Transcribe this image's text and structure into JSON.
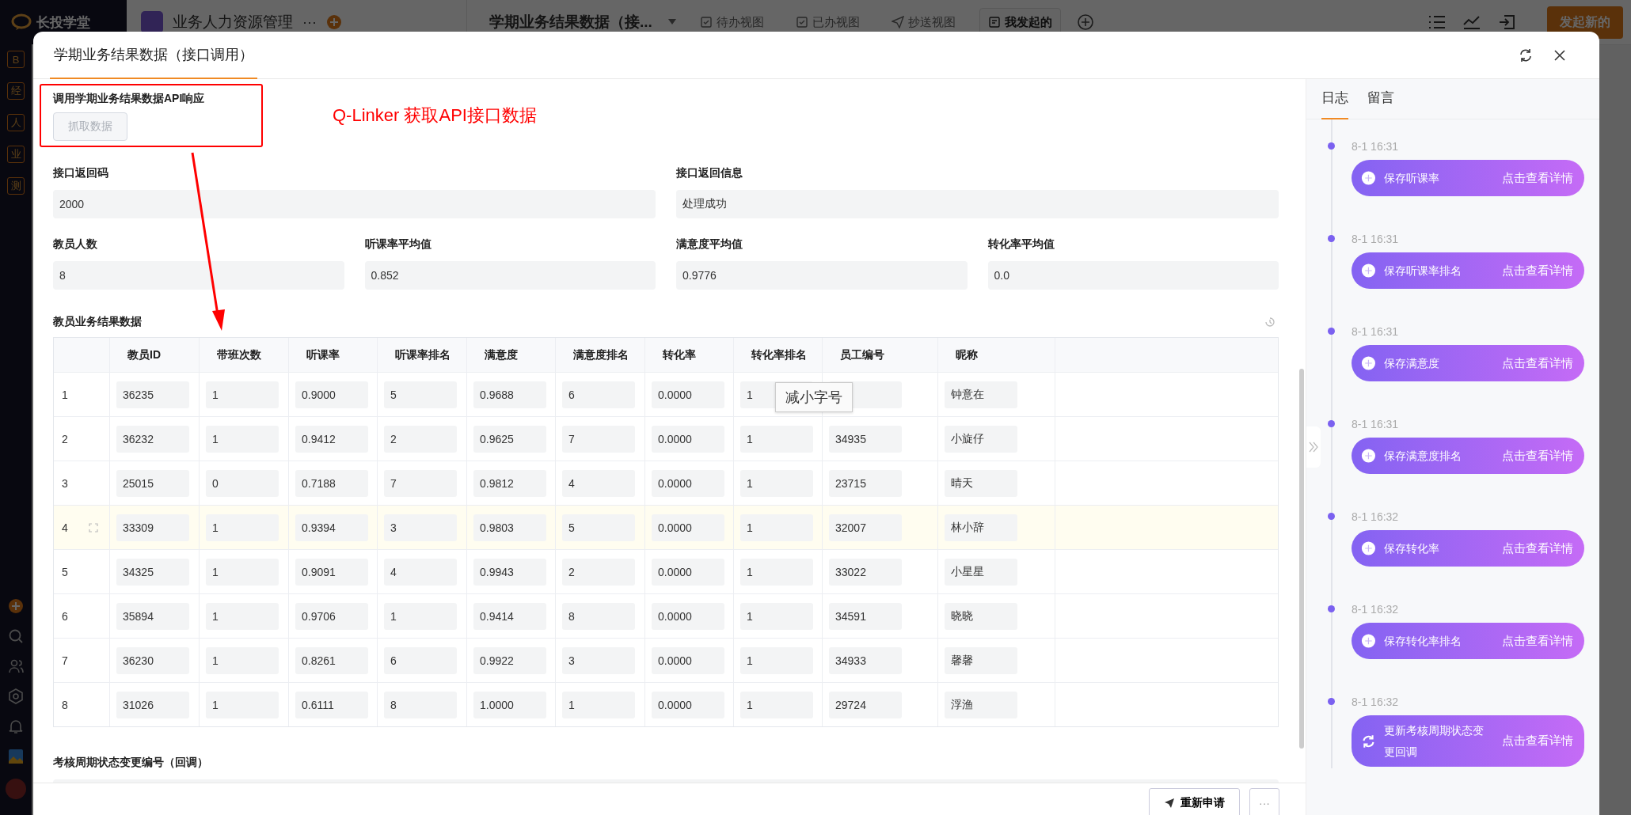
{
  "app": {
    "logo": "长投学堂",
    "app_name": "业务人力资源管理",
    "more": "···",
    "form_title": "学期业务结果数据（接...",
    "views": [
      {
        "label": "待办视图",
        "kind": "todo",
        "selected": false
      },
      {
        "label": "已办视图",
        "kind": "done",
        "selected": false
      },
      {
        "label": "抄送视图",
        "kind": "cc",
        "selected": false
      },
      {
        "label": "我发起的",
        "kind": "mine",
        "selected": true
      }
    ],
    "primary_button": "发起新的",
    "sidebar_letters": [
      "B",
      "经",
      "人",
      "业",
      "测"
    ]
  },
  "modal": {
    "tab": "学期业务结果数据（接口调用）",
    "api_section": {
      "label": "调用学期业务结果数据API响应",
      "button": "抓取数据",
      "button_disabled": true
    },
    "annotation": "Q-Linker 获取API接口数据",
    "field_rows": [
      [
        {
          "label": "接口返回码",
          "value": "2000"
        },
        {
          "label": "接口返回信息",
          "value": "处理成功"
        }
      ],
      [
        {
          "label": "教员人数",
          "value": "8"
        },
        {
          "label": "听课率平均值",
          "value": "0.852"
        },
        {
          "label": "满意度平均值",
          "value": "0.9776"
        },
        {
          "label": "转化率平均值",
          "value": "0.0"
        }
      ]
    ],
    "table": {
      "title": "教员业务结果数据",
      "columns": [
        "教员ID",
        "带班次数",
        "听课率",
        "听课率排名",
        "满意度",
        "满意度排名",
        "转化率",
        "转化率排名",
        "员工编号",
        "昵称"
      ],
      "rows": [
        {
          "index": "1",
          "highlighted": false,
          "cells": [
            "36235",
            "1",
            "0.9000",
            "5",
            "0.9688",
            "6",
            "0.0000",
            "1",
            null,
            "钟意在"
          ]
        },
        {
          "index": "2",
          "highlighted": false,
          "cells": [
            "36232",
            "1",
            "0.9412",
            "2",
            "0.9625",
            "7",
            "0.0000",
            "1",
            "34935",
            "小旋仔"
          ]
        },
        {
          "index": "3",
          "highlighted": false,
          "cells": [
            "25015",
            "0",
            "0.7188",
            "7",
            "0.9812",
            "4",
            "0.0000",
            "1",
            "23715",
            "晴天"
          ]
        },
        {
          "index": "4",
          "highlighted": true,
          "cells": [
            "33309",
            "1",
            "0.9394",
            "3",
            "0.9803",
            "5",
            "0.0000",
            "1",
            "32007",
            "林小辞"
          ]
        },
        {
          "index": "5",
          "highlighted": false,
          "cells": [
            "34325",
            "1",
            "0.9091",
            "4",
            "0.9943",
            "2",
            "0.0000",
            "1",
            "33022",
            "小星星"
          ]
        },
        {
          "index": "6",
          "highlighted": false,
          "cells": [
            "35894",
            "1",
            "0.9706",
            "1",
            "0.9414",
            "8",
            "0.0000",
            "1",
            "34591",
            "晓晓"
          ]
        },
        {
          "index": "7",
          "highlighted": false,
          "cells": [
            "36230",
            "1",
            "0.8261",
            "6",
            "0.9922",
            "3",
            "0.0000",
            "1",
            "34933",
            "馨馨"
          ]
        },
        {
          "index": "8",
          "highlighted": false,
          "cells": [
            "31026",
            "1",
            "0.6111",
            "8",
            "1.0000",
            "1",
            "0.0000",
            "1",
            "29724",
            "浮渔"
          ]
        }
      ]
    },
    "tooltip": "减小字号",
    "callback_field": {
      "label": "考核周期状态变更编号（回调）"
    },
    "footer": {
      "resubmit": "重新申请",
      "more": "···"
    },
    "side": {
      "tabs": [
        {
          "label": "日志",
          "selected": true
        },
        {
          "label": "留言",
          "selected": false
        }
      ],
      "log": [
        {
          "time": "8-1 16:31",
          "kind": "save",
          "action": "保存听课率",
          "link": "点击查看详情"
        },
        {
          "time": "8-1 16:31",
          "kind": "save",
          "action": "保存听课率排名",
          "link": "点击查看详情"
        },
        {
          "time": "8-1 16:31",
          "kind": "save",
          "action": "保存满意度",
          "link": "点击查看详情"
        },
        {
          "time": "8-1 16:31",
          "kind": "save",
          "action": "保存满意度排名",
          "link": "点击查看详情"
        },
        {
          "time": "8-1 16:32",
          "kind": "save",
          "action": "保存转化率",
          "link": "点击查看详情"
        },
        {
          "time": "8-1 16:32",
          "kind": "save",
          "action": "保存转化率排名",
          "link": "点击查看详情"
        },
        {
          "time": "8-1 16:32",
          "kind": "sync",
          "action": "更新考核周期状态变更回调",
          "link": "点击查看详情"
        }
      ]
    }
  }
}
